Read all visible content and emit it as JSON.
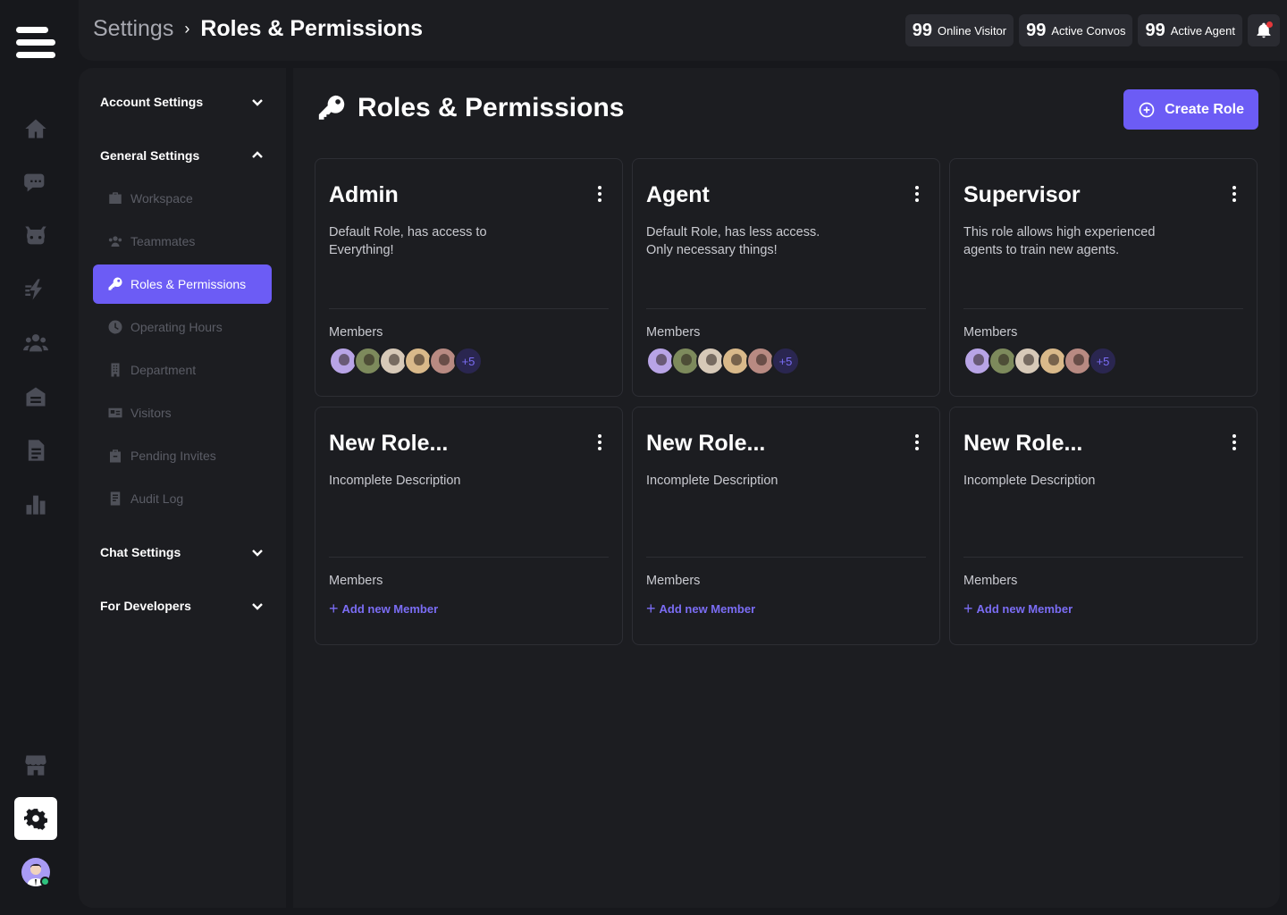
{
  "header": {
    "breadcrumb_root": "Settings",
    "breadcrumb_sep": "›",
    "breadcrumb_current": "Roles & Permissions",
    "stats": [
      {
        "num": "99",
        "label": "Online Visitor"
      },
      {
        "num": "99",
        "label": "Active Convos"
      },
      {
        "num": "99",
        "label": "Active Agent"
      }
    ]
  },
  "rail": {
    "icons": [
      "home-icon",
      "chat-icon",
      "bot-icon",
      "lightning-icon",
      "team-icon",
      "inbox-icon",
      "document-icon",
      "reports-icon",
      "store-icon"
    ],
    "settings_icon": "gear-icon"
  },
  "sidebar": {
    "groups": {
      "account": "Account Settings",
      "general": "General Settings",
      "chat": "Chat Settings",
      "developers": "For Developers"
    },
    "items": [
      {
        "label": "Workspace",
        "icon": "briefcase-icon"
      },
      {
        "label": "Teammates",
        "icon": "users-icon"
      },
      {
        "label": "Roles & Permissions",
        "icon": "key-icon",
        "active": true
      },
      {
        "label": "Operating Hours",
        "icon": "clock-icon"
      },
      {
        "label": "Department",
        "icon": "building-icon"
      },
      {
        "label": "Visitors",
        "icon": "id-card-icon"
      },
      {
        "label": "Pending Invites",
        "icon": "invite-icon"
      },
      {
        "label": "Audit Log",
        "icon": "log-icon"
      }
    ]
  },
  "main": {
    "title": "Roles & Permissions",
    "create_label": "Create Role",
    "members_label": "Members",
    "add_member_label": "Add new Member",
    "more_label": "+5",
    "roles": [
      {
        "title": "Admin",
        "description": "Default Role, has access to Everything!",
        "has_members": true
      },
      {
        "title": "Agent",
        "description": "Default Role, has less access. Only necessary things!",
        "has_members": true
      },
      {
        "title": "Supervisor",
        "description": "This role allows high experienced agents to train new agents.",
        "has_members": true
      },
      {
        "title": "New Role...",
        "description": "Incomplete Description",
        "has_members": false
      },
      {
        "title": "New Role...",
        "description": "Incomplete Description",
        "has_members": false
      },
      {
        "title": "New Role...",
        "description": "Incomplete Description",
        "has_members": false
      }
    ]
  },
  "colors": {
    "accent": "#6c5cf5",
    "background": "#17181c",
    "panel": "#1c1d21",
    "notification": "#e5383b",
    "online": "#2ec27e"
  }
}
